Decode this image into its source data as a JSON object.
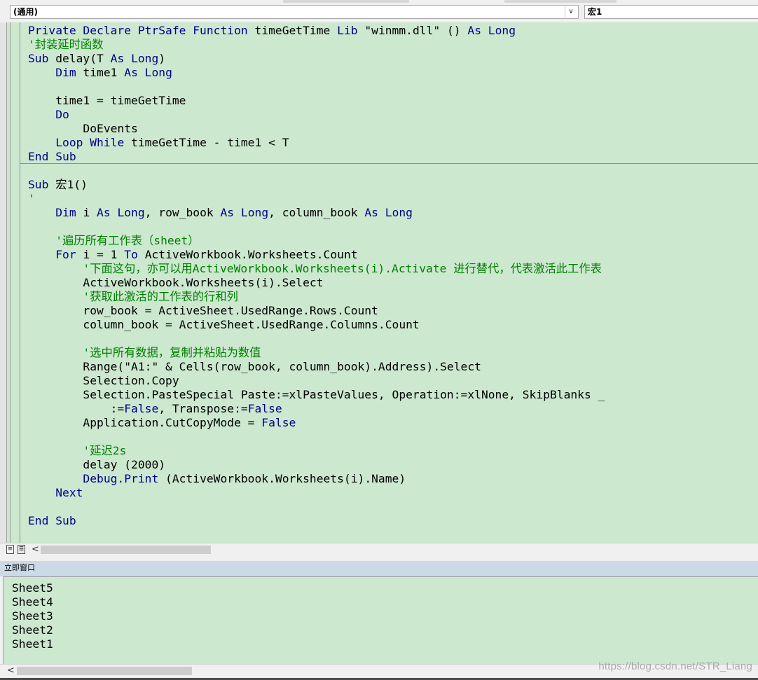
{
  "toolbar": {
    "object_combo": "(通用)",
    "procedure_combo": "宏1"
  },
  "code_lines": [
    [
      {
        "t": "Private Declare PtrSafe Function ",
        "c": "kw"
      },
      {
        "t": "timeGetTime "
      },
      {
        "t": "Lib ",
        "c": "kw"
      },
      {
        "t": "\"winmm.dll\" () "
      },
      {
        "t": "As Long",
        "c": "kw"
      }
    ],
    [
      {
        "t": "'封装延时函数",
        "c": "cm"
      }
    ],
    [
      {
        "t": "Sub ",
        "c": "kw"
      },
      {
        "t": "delay("
      },
      {
        "t": "T "
      },
      {
        "t": "As Long",
        "c": "kw"
      },
      {
        "t": ")"
      }
    ],
    [
      {
        "t": "    "
      },
      {
        "t": "Dim ",
        "c": "kw"
      },
      {
        "t": "time1 "
      },
      {
        "t": "As Long",
        "c": "kw"
      }
    ],
    [],
    [
      {
        "t": "    time1 = timeGetTime"
      }
    ],
    [
      {
        "t": "    "
      },
      {
        "t": "Do",
        "c": "kw"
      }
    ],
    [
      {
        "t": "        DoEvents"
      }
    ],
    [
      {
        "t": "    "
      },
      {
        "t": "Loop While ",
        "c": "kw"
      },
      {
        "t": "timeGetTime - time1 < T"
      }
    ],
    [
      {
        "t": "End Sub",
        "c": "kw"
      }
    ],
    [],
    [
      {
        "t": "Sub ",
        "c": "kw"
      },
      {
        "t": "宏1()"
      }
    ],
    [
      {
        "t": "'",
        "c": "cm"
      }
    ],
    [
      {
        "t": "    "
      },
      {
        "t": "Dim ",
        "c": "kw"
      },
      {
        "t": "i "
      },
      {
        "t": "As Long",
        "c": "kw"
      },
      {
        "t": ", row_book "
      },
      {
        "t": "As Long",
        "c": "kw"
      },
      {
        "t": ", column_book "
      },
      {
        "t": "As Long",
        "c": "kw"
      }
    ],
    [],
    [
      {
        "t": "    "
      },
      {
        "t": "'遍历所有工作表（sheet）",
        "c": "cm"
      }
    ],
    [
      {
        "t": "    "
      },
      {
        "t": "For ",
        "c": "kw"
      },
      {
        "t": "i = 1 "
      },
      {
        "t": "To ",
        "c": "kw"
      },
      {
        "t": "ActiveWorkbook.Worksheets.Count"
      }
    ],
    [
      {
        "t": "        "
      },
      {
        "t": "'下面这句，亦可以用ActiveWorkbook.Worksheets(i).Activate 进行替代，代表激活此工作表",
        "c": "cm"
      }
    ],
    [
      {
        "t": "        ActiveWorkbook.Worksheets(i).Select"
      }
    ],
    [
      {
        "t": "        "
      },
      {
        "t": "'获取此激活的工作表的行和列",
        "c": "cm"
      }
    ],
    [
      {
        "t": "        row_book = ActiveSheet.UsedRange.Rows.Count"
      }
    ],
    [
      {
        "t": "        column_book = ActiveSheet.UsedRange.Columns.Count"
      }
    ],
    [],
    [
      {
        "t": "        "
      },
      {
        "t": "'选中所有数据，复制并粘贴为数值",
        "c": "cm"
      }
    ],
    [
      {
        "t": "        Range(\"A1:\" & Cells(row_book, column_book).Address).Select"
      }
    ],
    [
      {
        "t": "        Selection.Copy"
      }
    ],
    [
      {
        "t": "        Selection.PasteSpecial Paste:=xlPasteValues, Operation:=xlNone, SkipBlanks _"
      }
    ],
    [
      {
        "t": "            :="
      },
      {
        "t": "False",
        "c": "kw"
      },
      {
        "t": ", Transpose:="
      },
      {
        "t": "False",
        "c": "kw"
      }
    ],
    [
      {
        "t": "        Application.CutCopyMode = "
      },
      {
        "t": "False",
        "c": "kw"
      }
    ],
    [],
    [
      {
        "t": "        "
      },
      {
        "t": "'延迟2s",
        "c": "cm"
      }
    ],
    [
      {
        "t": "        delay (2000)"
      }
    ],
    [
      {
        "t": "        "
      },
      {
        "t": "Debug.Print",
        "c": "kw"
      },
      {
        "t": " (ActiveWorkbook.Worksheets(i).Name)"
      }
    ],
    [
      {
        "t": "    "
      },
      {
        "t": "Next",
        "c": "kw"
      }
    ],
    [],
    [
      {
        "t": "End Sub",
        "c": "kw"
      }
    ]
  ],
  "immediate": {
    "title": "立即窗口",
    "lines": [
      "Sheet5",
      "Sheet4",
      "Sheet3",
      "Sheet2",
      "Sheet1"
    ]
  },
  "icons": {
    "procedure_view": "≡",
    "full_module_view": "≣",
    "scroll_left": "<",
    "dropdown": "∨"
  },
  "watermark": "https://blog.csdn.net/STR_Liang",
  "colors": {
    "background": "#cce8cf",
    "keyword": "#00008b",
    "comment": "#008000"
  }
}
